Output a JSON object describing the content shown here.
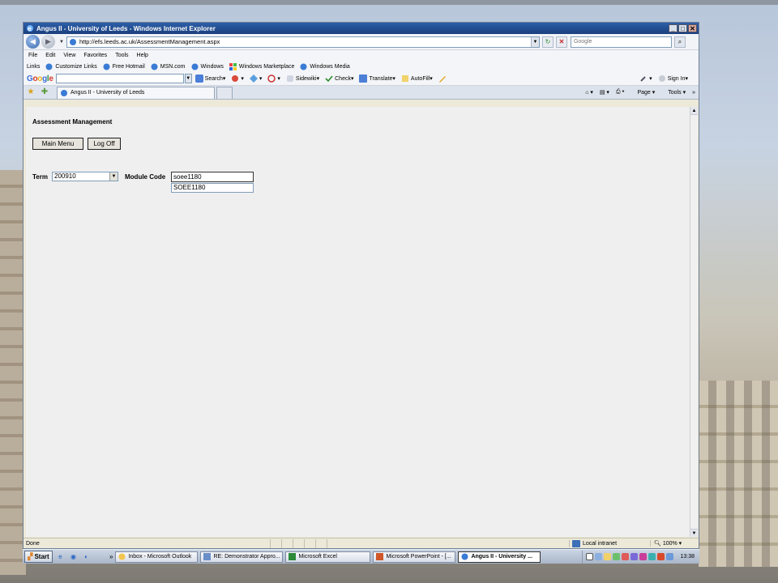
{
  "window": {
    "title": "Angus II - University of Leeds - Windows Internet Explorer",
    "controls": [
      "_",
      "□",
      "✕"
    ]
  },
  "address": {
    "url": "http://efs.leeds.ac.uk/AssessmentManagement.aspx",
    "search_placeholder": "Google"
  },
  "menu": [
    "File",
    "Edit",
    "View",
    "Favorites",
    "Tools",
    "Help"
  ],
  "links": {
    "label": "Links",
    "items": [
      "Customize Links",
      "Free Hotmail",
      "MSN.com",
      "Windows",
      "Windows Marketplace",
      "Windows Media"
    ]
  },
  "googlebar": {
    "logo": "Google",
    "search": "Search",
    "sidewiki": "Sidewiki",
    "check": "Check",
    "translate": "Translate",
    "autofill": "AutoFill",
    "signin": "Sign In"
  },
  "tabs": {
    "active": "Angus II - University of Leeds",
    "page": "Page",
    "tools": "Tools"
  },
  "page": {
    "title": "Assessment Management",
    "main_menu_btn": "Main Menu",
    "logoff_btn": "Log Off",
    "term_label": "Term",
    "term_value": "200910",
    "module_label": "Module Code",
    "module_value": "soee1180",
    "suggestion": "SOEE1180"
  },
  "status": {
    "text": "Done",
    "zone": "Local intranet",
    "zoom": "100%"
  },
  "taskbar": {
    "start": "Start",
    "buttons": [
      "Inbox - Microsoft Outlook",
      "RE: Demonstrator Appro...",
      "Microsoft Excel",
      "Microsoft PowerPoint - [...",
      "Angus II - University ..."
    ],
    "clock": "13:38"
  },
  "colors": {
    "title_bar": "#1a3f7d",
    "content_bg": "#efefef",
    "button_face": "#e6e4dc"
  }
}
